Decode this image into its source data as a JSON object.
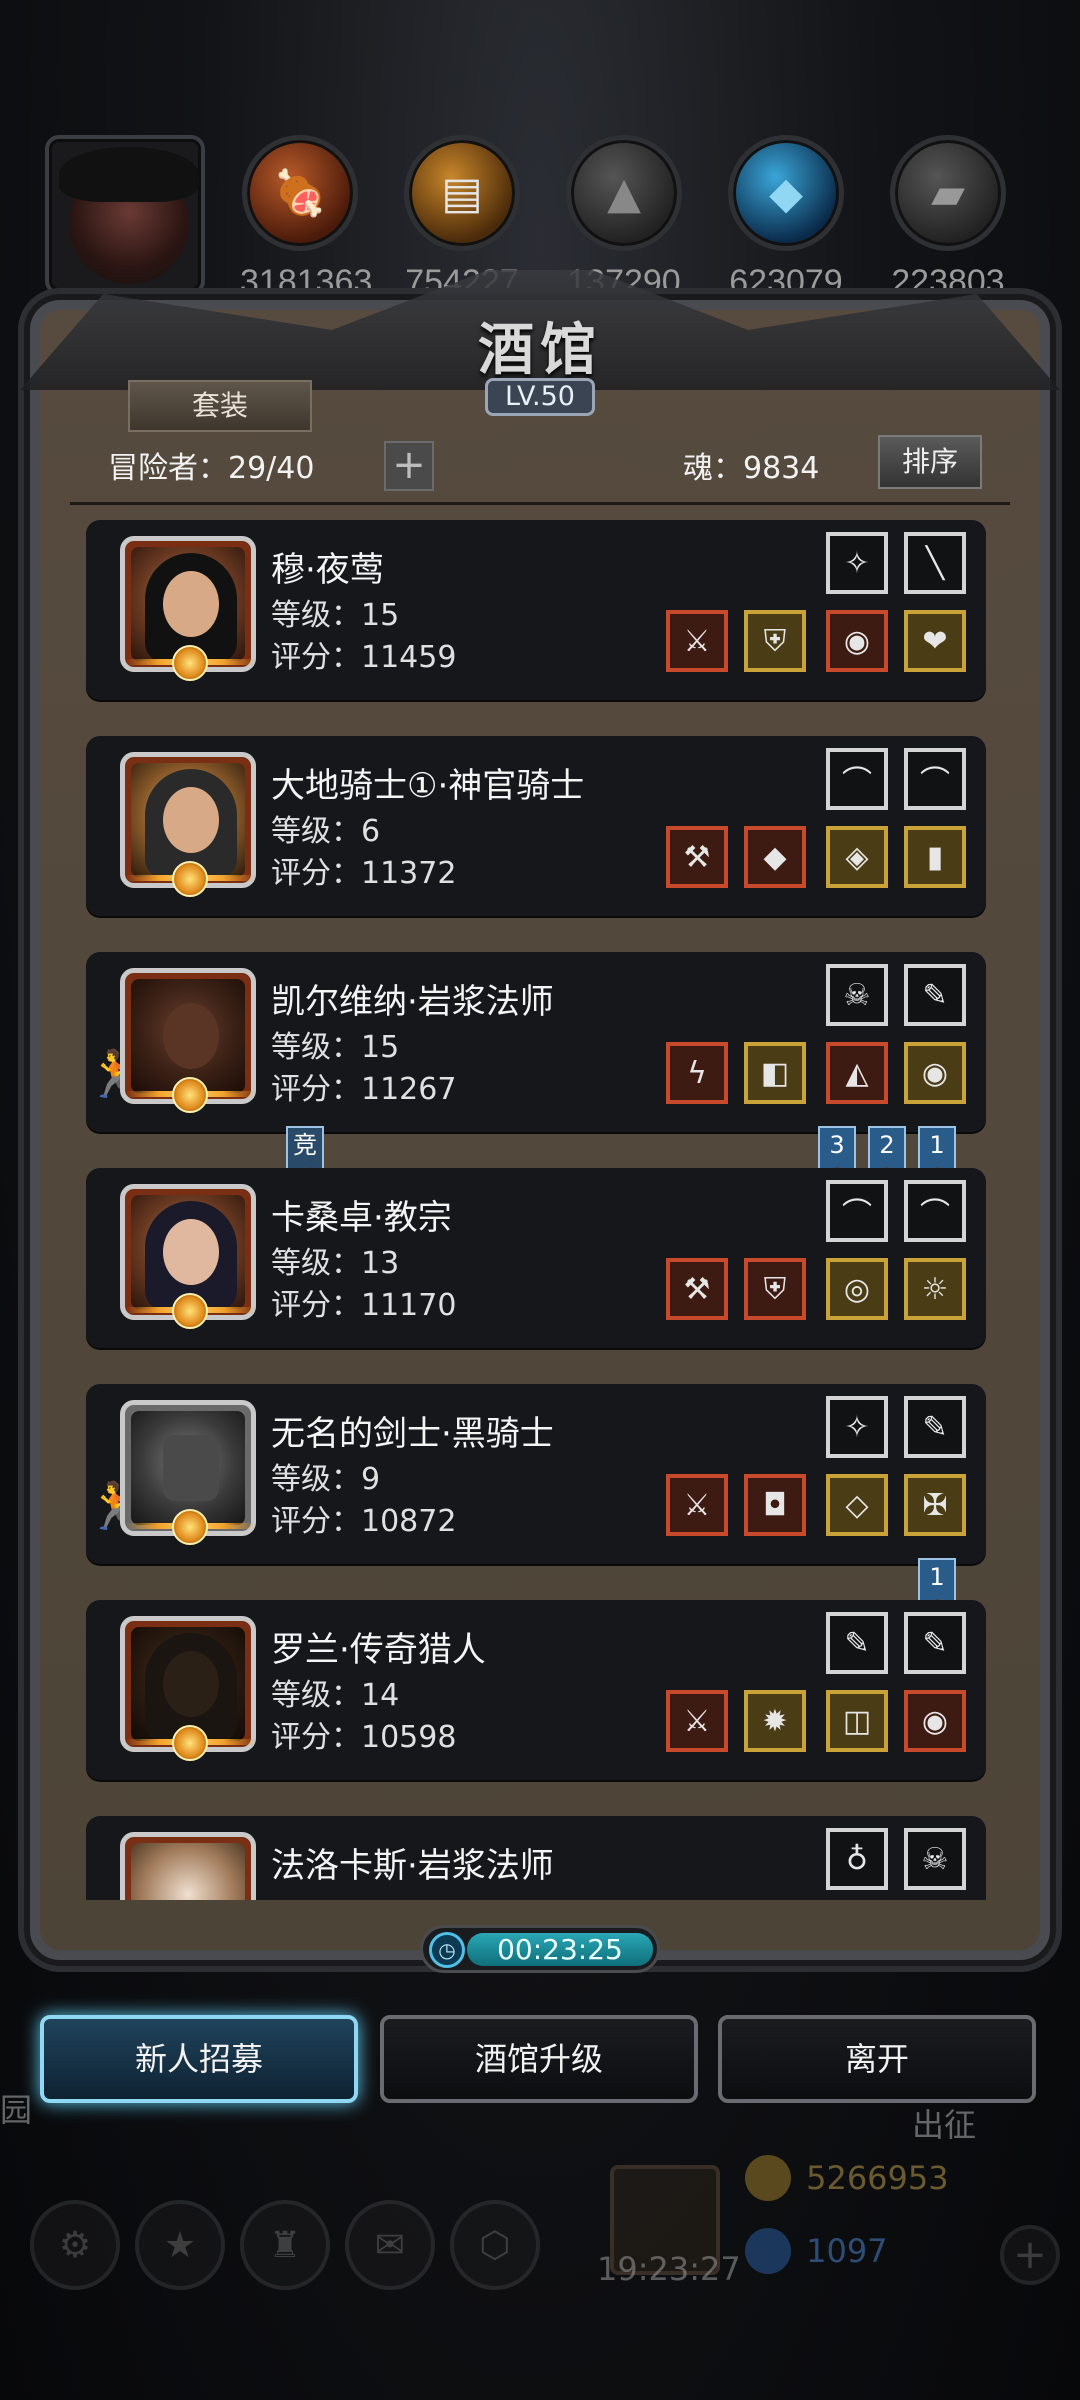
{
  "header": {
    "title": "酒馆",
    "level": "LV.50"
  },
  "resources": [
    {
      "icon": "meat-icon",
      "value": "3181363"
    },
    {
      "icon": "wood-icon",
      "value": "754227"
    },
    {
      "icon": "stone-icon",
      "value": "137290"
    },
    {
      "icon": "crystal-icon",
      "value": "623079"
    },
    {
      "icon": "iron-icon",
      "value": "223803"
    }
  ],
  "tavern": {
    "suit_tab": "套装",
    "adventurers": "冒险者：29/40",
    "plus": "+",
    "soul": "魂：9834",
    "sort": "排序"
  },
  "heroes": [
    {
      "name": "穆·夜莺",
      "level": "等级：15",
      "score": "评分：11459",
      "skills": [
        "✧",
        "╲"
      ],
      "gear": [
        "⚔",
        "⛨",
        "◉",
        "❤"
      ]
    },
    {
      "name": "大地骑士①·神官骑士",
      "level": "等级：6",
      "score": "评分：11372",
      "skills": [
        "⌒",
        "⌒"
      ],
      "gear": [
        "⚒",
        "◆",
        "◈",
        "▮"
      ]
    },
    {
      "name": "凯尔维纳·岩浆法师",
      "level": "等级：15",
      "score": "评分：11267",
      "skills": [
        "☠",
        "✎"
      ],
      "gear": [
        "ϟ",
        "◧",
        "◭",
        "◉"
      ],
      "tag": "竞",
      "flags": [
        "3",
        "2",
        "1"
      ]
    },
    {
      "name": "卡桑卓·教宗",
      "level": "等级：13",
      "score": "评分：11170",
      "skills": [
        "⌒",
        "⌒"
      ],
      "gear": [
        "⚒",
        "⛨",
        "◎",
        "☼"
      ]
    },
    {
      "name": "无名的剑士·黑骑士",
      "level": "等级：9",
      "score": "评分：10872",
      "skills": [
        "✧",
        "✎"
      ],
      "gear": [
        "⚔",
        "◘",
        "◇",
        "✠"
      ],
      "flags": [
        "1"
      ]
    },
    {
      "name": "罗兰·传奇猎人",
      "level": "等级：14",
      "score": "评分：10598",
      "skills": [
        "✎",
        "✎"
      ],
      "gear": [
        "⚔",
        "✹",
        "◫",
        "◉"
      ]
    },
    {
      "name": "法洛卡斯·岩浆法师",
      "level": "",
      "score": "",
      "skills": [
        "♁",
        "☠"
      ],
      "gear": []
    }
  ],
  "timer": "00:23:25",
  "buttons": {
    "recruit": "新人招募",
    "upgrade": "酒馆升级",
    "leave": "离开"
  },
  "background_hud": {
    "expedition": "出征",
    "gold": "5266953",
    "gems": "1097",
    "clock": "19:23:27",
    "garden_partial": "园"
  },
  "colors": {
    "accent_blue": "#8fd7f2",
    "gold_text": "#b99a4a",
    "frame": "#4a4b50"
  }
}
